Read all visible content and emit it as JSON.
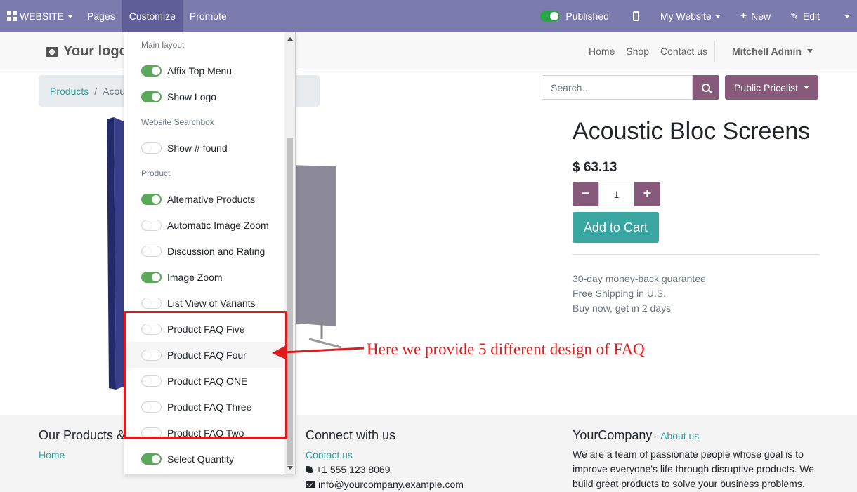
{
  "topbar": {
    "website_label": "WEBSITE",
    "pages_label": "Pages",
    "customize_label": "Customize",
    "promote_label": "Promote",
    "published_label": "Published",
    "my_website_label": "My Website",
    "new_label": "New",
    "edit_label": "Edit"
  },
  "header": {
    "logo_text": "Your logo",
    "nav": [
      "Home",
      "Shop",
      "Contact us"
    ],
    "user": "Mitchell Admin"
  },
  "breadcrumb": {
    "products": "Products",
    "separator": "/",
    "current": "Acoustic Bloc Screens"
  },
  "search": {
    "placeholder": "Search..."
  },
  "pricelist": "Public Pricelist",
  "product": {
    "title": "Acoustic Bloc Screens",
    "price": "$ 63.13",
    "quantity": "1",
    "add_to_cart": "Add to Cart",
    "perks": [
      "30-day money-back guarantee",
      "Free Shipping in U.S.",
      "Buy now, get in 2 days"
    ]
  },
  "customize_menu": {
    "sections": [
      {
        "title": "Main layout",
        "options": [
          {
            "label": "Affix Top Menu",
            "on": true
          },
          {
            "label": "Show Logo",
            "on": true
          }
        ]
      },
      {
        "title": "Website Searchbox",
        "options": [
          {
            "label": "Show # found",
            "on": false
          }
        ]
      },
      {
        "title": "Product",
        "options": [
          {
            "label": "Alternative Products",
            "on": true
          },
          {
            "label": "Automatic Image Zoom",
            "on": false
          },
          {
            "label": "Discussion and Rating",
            "on": false
          },
          {
            "label": "Image Zoom",
            "on": true
          },
          {
            "label": "List View of Variants",
            "on": false
          },
          {
            "label": "Product FAQ Five",
            "on": false
          },
          {
            "label": "Product FAQ Four",
            "on": false
          },
          {
            "label": "Product FAQ ONE",
            "on": false
          },
          {
            "label": "Product FAQ Three",
            "on": false
          },
          {
            "label": "Product FAQ Two",
            "on": false
          },
          {
            "label": "Select Quantity",
            "on": true
          }
        ]
      }
    ]
  },
  "annotation": {
    "text": "Here we provide 5 different design of FAQ",
    "color": "#e01b1b"
  },
  "footer": {
    "col1_title": "Our Products &",
    "col1_link": "Home",
    "col2_title": "Connect with us",
    "col2_link": "Contact us",
    "phone": "+1 555 123 8069",
    "email": "info@yourcompany.example.com",
    "col3_title": "YourCompany",
    "col3_title_sep": " - ",
    "col3_link": "About us",
    "col3_text": "We are a team of passionate people whose goal is to improve everyone's life through disruptive products. We build great products to solve your business problems."
  },
  "colors": {
    "topbar": "#7c7bad",
    "primary": "#875a7b",
    "accent": "#3aa6a1",
    "toggle_on": "#5aa85a"
  }
}
